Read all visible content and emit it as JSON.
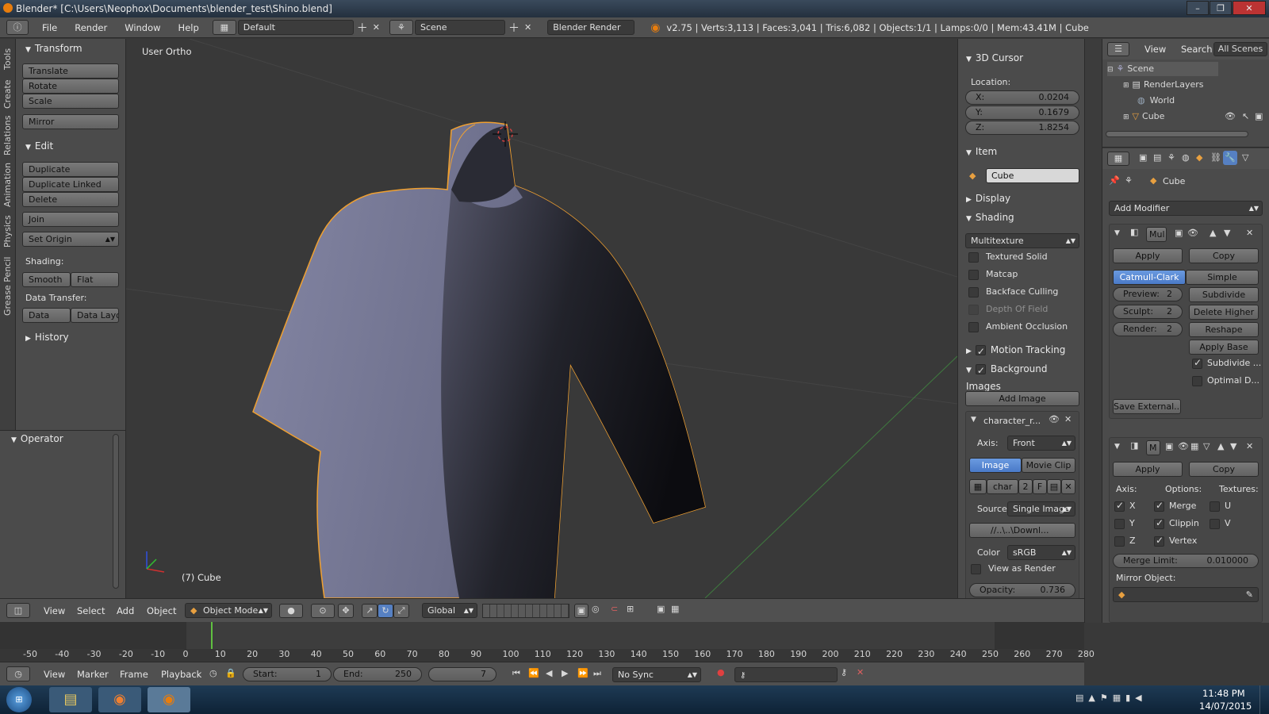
{
  "window": {
    "title": "Blender* [C:\\Users\\Neophox\\Documents\\blender_test\\Shino.blend]"
  },
  "info_header": {
    "menus": [
      "File",
      "Render",
      "Window",
      "Help"
    ],
    "layout": "Default",
    "scene": "Scene",
    "engine": "Blender Render",
    "stats": "v2.75 | Verts:3,113 | Faces:3,041 | Tris:6,082 | Objects:1/1 | Lamps:0/0 | Mem:43.41M | Cube"
  },
  "left_tabs": [
    "Tools",
    "Create",
    "Relations",
    "Animation",
    "Physics",
    "Grease Pencil"
  ],
  "tool_shelf": {
    "transform": {
      "title": "Transform",
      "buttons": [
        "Translate",
        "Rotate",
        "Scale",
        "Mirror"
      ]
    },
    "edit": {
      "title": "Edit",
      "buttons": [
        "Duplicate",
        "Duplicate Linked",
        "Delete",
        "Join"
      ],
      "set_origin": "Set Origin"
    },
    "shading_label": "Shading:",
    "smooth": "Smooth",
    "flat": "Flat",
    "data_transfer_label": "Data Transfer:",
    "data": "Data",
    "data_layo": "Data Layo",
    "history": "History",
    "operator": "Operator"
  },
  "viewport": {
    "view_label": "User Ortho",
    "object_label": "(7) Cube"
  },
  "properties_panel": {
    "cursor_title": "3D Cursor",
    "location_label": "Location:",
    "x_label": "X:",
    "x": "0.0204",
    "y_label": "Y:",
    "y": "0.1679",
    "z_label": "Z:",
    "z": "1.8254",
    "item_title": "Item",
    "item_name": "Cube",
    "display_title": "Display",
    "shading_title": "Shading",
    "shading_mode": "Multitexture",
    "checks": [
      {
        "label": "Textured Solid",
        "on": false,
        "dim": false
      },
      {
        "label": "Matcap",
        "on": false,
        "dim": false
      },
      {
        "label": "Backface Culling",
        "on": false,
        "dim": false
      },
      {
        "label": "Depth Of Field",
        "on": false,
        "dim": true
      },
      {
        "label": "Ambient Occlusion",
        "on": false,
        "dim": false
      }
    ],
    "motion_tracking": "Motion Tracking",
    "background_images": "Background Images",
    "add_image": "Add Image",
    "bg_name": "character_r...",
    "axis_label": "Axis:",
    "axis": "Front",
    "image_tab": "Image",
    "movie_clip_tab": "Movie Clip",
    "img_name": "char",
    "img_users": "2",
    "img_fake": "F",
    "source_label": "Source",
    "source": "Single Image",
    "path": "//..\\..\\Downl...",
    "color_label": "Color",
    "color": "sRGB",
    "view_as_render": "View as Render",
    "opacity_label": "Opacity:",
    "opacity": "0.736"
  },
  "outliner": {
    "menus": [
      "View",
      "Search"
    ],
    "filter": "All Scenes",
    "items": [
      "Scene",
      "RenderLayers",
      "World",
      "Cube"
    ]
  },
  "modifiers": {
    "object_name": "Cube",
    "add_modifier": "Add Modifier",
    "mod1_name": "Mul",
    "apply": "Apply",
    "copy": "Copy",
    "catmull": "Catmull-Clark",
    "simple": "Simple",
    "preview_label": "Preview:",
    "preview": "2",
    "sculpt_label": "Sculpt:",
    "sculpt": "2",
    "render_label": "Render:",
    "render": "2",
    "subdivide": "Subdivide",
    "delete_higher": "Delete Higher",
    "reshape": "Reshape",
    "apply_base": "Apply Base",
    "subdivide_uvs": "Subdivide ...",
    "optimal": "Optimal D...",
    "save_external": "Save External...",
    "mod2_name": "M",
    "axis_label": "Axis:",
    "options_label": "Options:",
    "textures_label": "Textures:",
    "x": "X",
    "y": "Y",
    "z": "Z",
    "merge": "Merge",
    "clipping": "Clippin",
    "vertex": "Vertex",
    "u": "U",
    "v": "V",
    "merge_limit_label": "Merge Limit:",
    "merge_limit": "0.010000",
    "mirror_object": "Mirror Object:"
  },
  "view3d_header": {
    "menus": [
      "View",
      "Select",
      "Add",
      "Object"
    ],
    "mode": "Object Mode",
    "orientation": "Global"
  },
  "timeline": {
    "ticks": [
      "-50",
      "-40",
      "-30",
      "-20",
      "-10",
      "0",
      "10",
      "20",
      "30",
      "40",
      "50",
      "60",
      "70",
      "80",
      "90",
      "100",
      "110",
      "120",
      "130",
      "140",
      "150",
      "160",
      "170",
      "180",
      "190",
      "200",
      "210",
      "220",
      "230",
      "240",
      "250",
      "260",
      "270",
      "280"
    ],
    "current_frame": 7,
    "menus": [
      "View",
      "Marker",
      "Frame",
      "Playback"
    ],
    "start_label": "Start:",
    "start": "1",
    "end_label": "End:",
    "end": "250",
    "frame": "7",
    "sync": "No Sync"
  },
  "taskbar": {
    "time": "11:48 PM",
    "date": "14/07/2015"
  },
  "colors": {
    "accent_blue": "#5680c2",
    "outline_orange": "#f0a030",
    "viewport_bg": "#393939"
  }
}
